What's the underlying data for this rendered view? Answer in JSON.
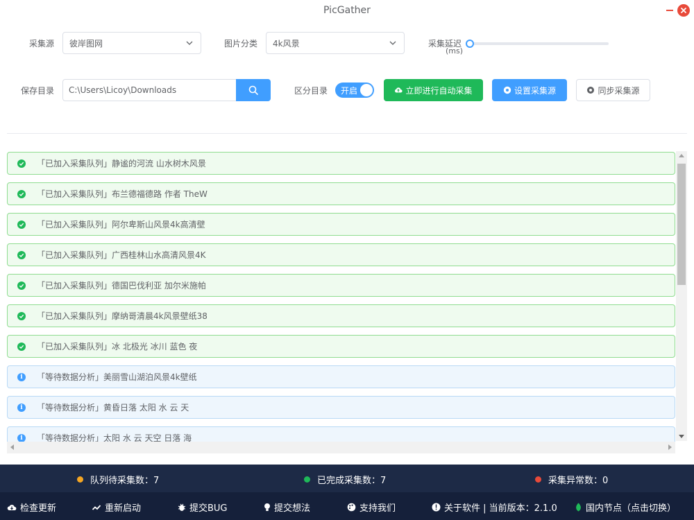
{
  "app": {
    "title": "PicGather"
  },
  "form": {
    "source_label": "采集源",
    "source_value": "彼岸图网",
    "category_label": "图片分类",
    "category_value": "4k风景",
    "delay_label": "采集延迟",
    "delay_unit": "(ms)",
    "delay_value": 0,
    "save_dir_label": "保存目录",
    "save_dir_value": "C:\\Users\\Licoy\\Downloads",
    "split_dir_label": "区分目录",
    "split_dir_toggle": "开启",
    "split_dir_on": true
  },
  "buttons": {
    "auto_collect": "立即进行自动采集",
    "set_source": "设置采集源",
    "sync_source": "同步采集源"
  },
  "log": [
    {
      "status": "success",
      "text": "「已加入采集队列」静谧的河流 山水树木风景"
    },
    {
      "status": "success",
      "text": "「已加入采集队列」布兰德福德路 作者 TheW"
    },
    {
      "status": "success",
      "text": "「已加入采集队列」阿尔卑斯山风景4k高清壁"
    },
    {
      "status": "success",
      "text": "「已加入采集队列」广西桂林山水高清风景4K"
    },
    {
      "status": "success",
      "text": "「已加入采集队列」德国巴伐利亚 加尔米施帕"
    },
    {
      "status": "success",
      "text": "「已加入采集队列」摩纳哥清晨4k风景壁纸38"
    },
    {
      "status": "success",
      "text": "「已加入采集队列」冰 北极光 冰川 蓝色 夜"
    },
    {
      "status": "info",
      "text": "「等待数据分析」美丽雪山湖泊风景4k壁纸"
    },
    {
      "status": "info",
      "text": "「等待数据分析」黄昏日落 太阳 水 云 天"
    },
    {
      "status": "info",
      "text": "「等待数据分析」太阳 水 云 天空 日落 海"
    }
  ],
  "stats": {
    "queue_label": "队列待采集数：7",
    "done_label": "已完成采集数：7",
    "error_label": "采集异常数：0",
    "queue_color": "#f5a623",
    "done_color": "#1fb959",
    "error_color": "#e84a3a"
  },
  "footer": {
    "check_update": "检查更新",
    "restart": "重新启动",
    "submit_bug": "提交BUG",
    "submit_idea": "提交想法",
    "support_us": "支持我们",
    "about": "关于软件 | 当前版本：2.1.0",
    "node": "国内节点（点击切换）"
  },
  "colors": {
    "accent": "#409eff",
    "success": "#1fb959",
    "footer_bg": "#15203a",
    "stats_bg": "#1d2a46"
  }
}
